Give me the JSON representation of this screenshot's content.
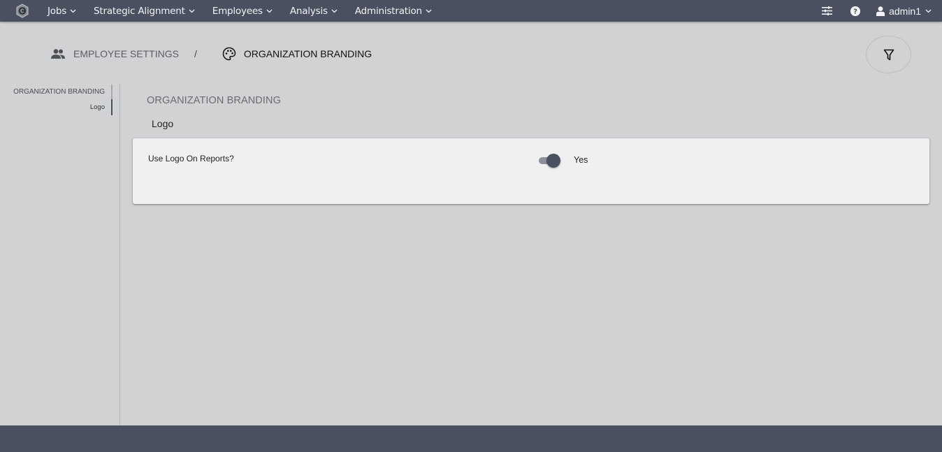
{
  "topbar": {
    "logo_icon": "hexagon-logo-icon",
    "nav": [
      {
        "label": "Jobs"
      },
      {
        "label": "Strategic Alignment"
      },
      {
        "label": "Employees"
      },
      {
        "label": "Analysis"
      },
      {
        "label": "Administration"
      }
    ],
    "tools": {
      "settings_icon": "sliders-icon",
      "help_icon": "help-circle-icon"
    },
    "user": {
      "name": "admin1",
      "icon": "user-icon"
    }
  },
  "breadcrumb": {
    "items": [
      {
        "label": "EMPLOYEE SETTINGS",
        "icon": "people-icon"
      },
      {
        "label": "ORGANIZATION BRANDING",
        "icon": "palette-icon"
      }
    ],
    "separator": "/"
  },
  "filter_button": {
    "icon": "filter-icon"
  },
  "sidenav": {
    "group": "ORGANIZATION BRANDING",
    "items": [
      {
        "label": "Logo",
        "active": true
      }
    ]
  },
  "main": {
    "section_title": "ORGANIZATION BRANDING",
    "subsection_title": "Logo",
    "fields": [
      {
        "label": "Use Logo On Reports?",
        "type": "toggle",
        "value": true,
        "value_label": "Yes"
      }
    ]
  },
  "colors": {
    "topbar": "#4a5060",
    "background": "#d1d2d4",
    "card": "#f0f0f0",
    "accent": "#4a5060"
  }
}
